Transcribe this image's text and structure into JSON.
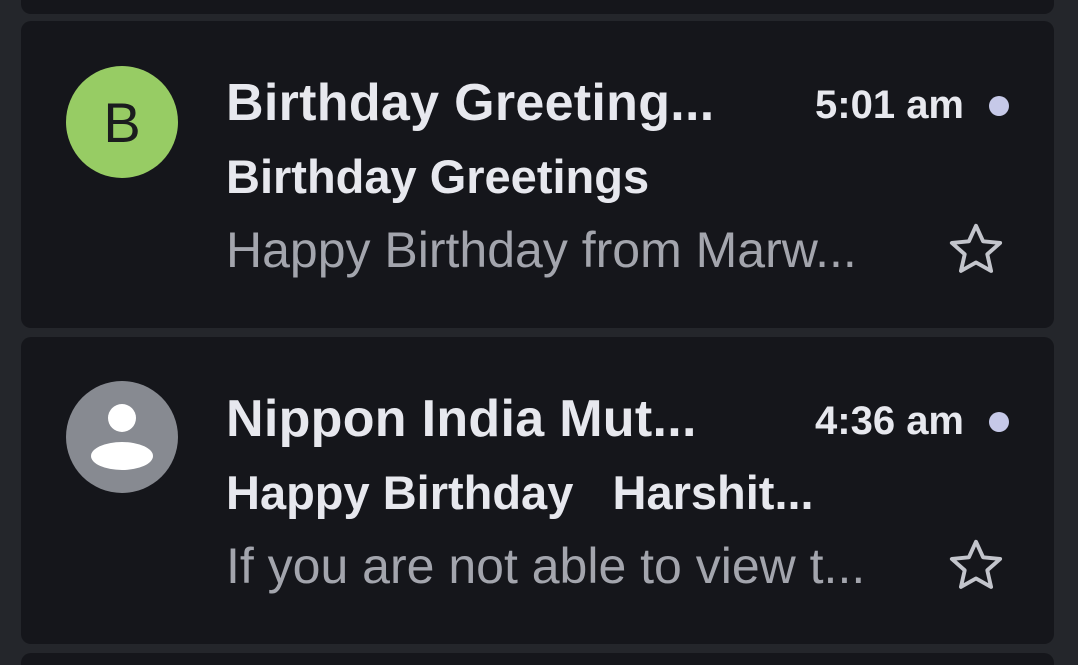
{
  "emails": [
    {
      "avatar_letter": "B",
      "avatar_color": "#97cc64",
      "sender": "Birthday Greeting...",
      "time": "5:01 am",
      "subject": "Birthday Greetings",
      "preview": "Happy Birthday from Marw...",
      "unread": true,
      "starred": false
    },
    {
      "avatar_icon": "person-icon",
      "avatar_color": "#878a91",
      "sender": "Nippon India Mut...",
      "time": "4:36 am",
      "subject": "Happy Birthday   Harshit...",
      "preview": "If you are not able to view t...",
      "unread": true,
      "starred": false
    }
  ]
}
